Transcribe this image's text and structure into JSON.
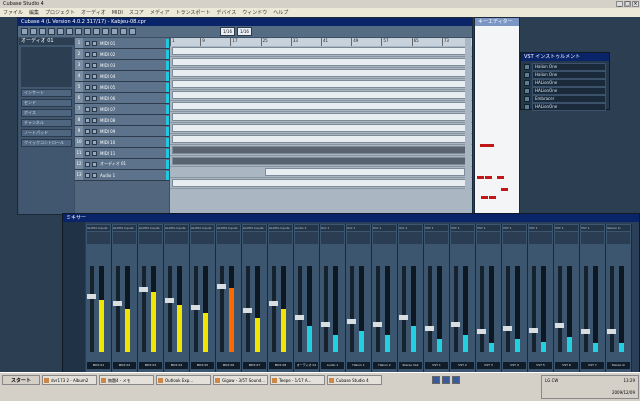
{
  "app": {
    "title": "Cubase Studio 4",
    "menus": [
      "ファイル",
      "編集",
      "プロジェクト",
      "オーディオ",
      "MIDI",
      "スコア",
      "メディア",
      "トランスポート",
      "デバイス",
      "ウィンドウ",
      "ヘルプ"
    ]
  },
  "project": {
    "title": "Cubase 4 (L Version 4.0.2 317/17) - Kabjeu-08.cpr",
    "inspector_title": "オーディオ 01",
    "inspector_rows": [
      "インサート",
      "センド",
      "ボイス",
      "チャンネル",
      "ノートパッド",
      "クイックコントロール"
    ],
    "tracks": [
      {
        "num": "1",
        "name": "MIDI 01"
      },
      {
        "num": "2",
        "name": "MIDI 02"
      },
      {
        "num": "3",
        "name": "MIDI 03"
      },
      {
        "num": "4",
        "name": "MIDI 04"
      },
      {
        "num": "5",
        "name": "MIDI 05"
      },
      {
        "num": "6",
        "name": "MIDI 06"
      },
      {
        "num": "7",
        "name": "MIDI 07"
      },
      {
        "num": "8",
        "name": "MIDI 08"
      },
      {
        "num": "9",
        "name": "MIDI 09"
      },
      {
        "num": "10",
        "name": "MIDI 10"
      },
      {
        "num": "11",
        "name": "MIDI 11"
      },
      {
        "num": "12",
        "name": "オーディオ 01"
      },
      {
        "num": "13",
        "name": "Audio 1"
      }
    ],
    "ruler": [
      "1",
      "9",
      "17",
      "25",
      "33",
      "41",
      "49",
      "57",
      "65",
      "73"
    ],
    "grid_select": "1/16",
    "quant_select": "1/16"
  },
  "key_editor": {
    "title": "キーエディター"
  },
  "vsti": {
    "title": "VST インストゥルメント",
    "slots": [
      "Halion One",
      "Halion One",
      "HALionOne",
      "HALionOne",
      "Embracer",
      "HALionOne"
    ]
  },
  "mixer": {
    "title": "ミキサー",
    "strips": [
      {
        "in": "ALOHA Inputs",
        "name": "MIDI 01",
        "level": 0.6,
        "color": "#f2e600"
      },
      {
        "in": "ALOHA Inputs",
        "name": "MIDI 02",
        "level": 0.5,
        "color": "#f2e600"
      },
      {
        "in": "ALOHA Inputs",
        "name": "MIDI 03",
        "level": 0.7,
        "color": "#f2e600"
      },
      {
        "in": "ALOHA Inputs",
        "name": "MIDI 04",
        "level": 0.55,
        "color": "#f2e600"
      },
      {
        "in": "ALOHA Inputs",
        "name": "MIDI 05",
        "level": 0.45,
        "color": "#f2e600"
      },
      {
        "in": "ALOHA Inputs",
        "name": "MIDI 06",
        "level": 0.75,
        "color": "#ff6a00"
      },
      {
        "in": "ALOHA Inputs",
        "name": "MIDI 07",
        "level": 0.4,
        "color": "#f2e600"
      },
      {
        "in": "ALOHA Inputs",
        "name": "MIDI 08",
        "level": 0.5,
        "color": "#f2e600"
      },
      {
        "in": "Audio 1",
        "name": "オーディオ 01",
        "level": 0.3,
        "color": "#22d0e0"
      },
      {
        "in": "Out 1",
        "name": "Audio 1",
        "level": 0.2,
        "color": "#22d0e0"
      },
      {
        "in": "Out 1",
        "name": "Halion 1",
        "level": 0.25,
        "color": "#22d0e0"
      },
      {
        "in": "Out 1",
        "name": "Halion 2",
        "level": 0.2,
        "color": "#22d0e0"
      },
      {
        "in": "Out 1",
        "name": "Stereo Out",
        "level": 0.3,
        "color": "#22d0e0"
      },
      {
        "in": "VST 1",
        "name": "VST 1",
        "level": 0.15,
        "color": "#22d0e0"
      },
      {
        "in": "VST 1",
        "name": "VST 2",
        "level": 0.2,
        "color": "#22d0e0"
      },
      {
        "in": "VST 1",
        "name": "VST 3",
        "level": 0.1,
        "color": "#22d0e0"
      },
      {
        "in": "VST 1",
        "name": "VST 4",
        "level": 0.15,
        "color": "#22d0e0"
      },
      {
        "in": "VST 1",
        "name": "VST 5",
        "level": 0.12,
        "color": "#22d0e0"
      },
      {
        "in": "VST 1",
        "name": "VST 6",
        "level": 0.18,
        "color": "#22d0e0"
      },
      {
        "in": "VST 1",
        "name": "VST 7",
        "level": 0.1,
        "color": "#22d0e0"
      },
      {
        "in": "Stereo In",
        "name": "Stereo In",
        "level": 0.1,
        "color": "#22d0e0"
      }
    ]
  },
  "taskbar": {
    "start": "スタート",
    "buttons": [
      "dvr173 2 - Album2",
      "無題4 - メモ",
      "Outlook Exp...",
      "Gigaw - 3/5T Sound...",
      "Teepe - 1/17 A...",
      "Cubase Studio 4"
    ],
    "time": "13:29",
    "date": "2009/12/09",
    "tray_label": "LG CW"
  }
}
